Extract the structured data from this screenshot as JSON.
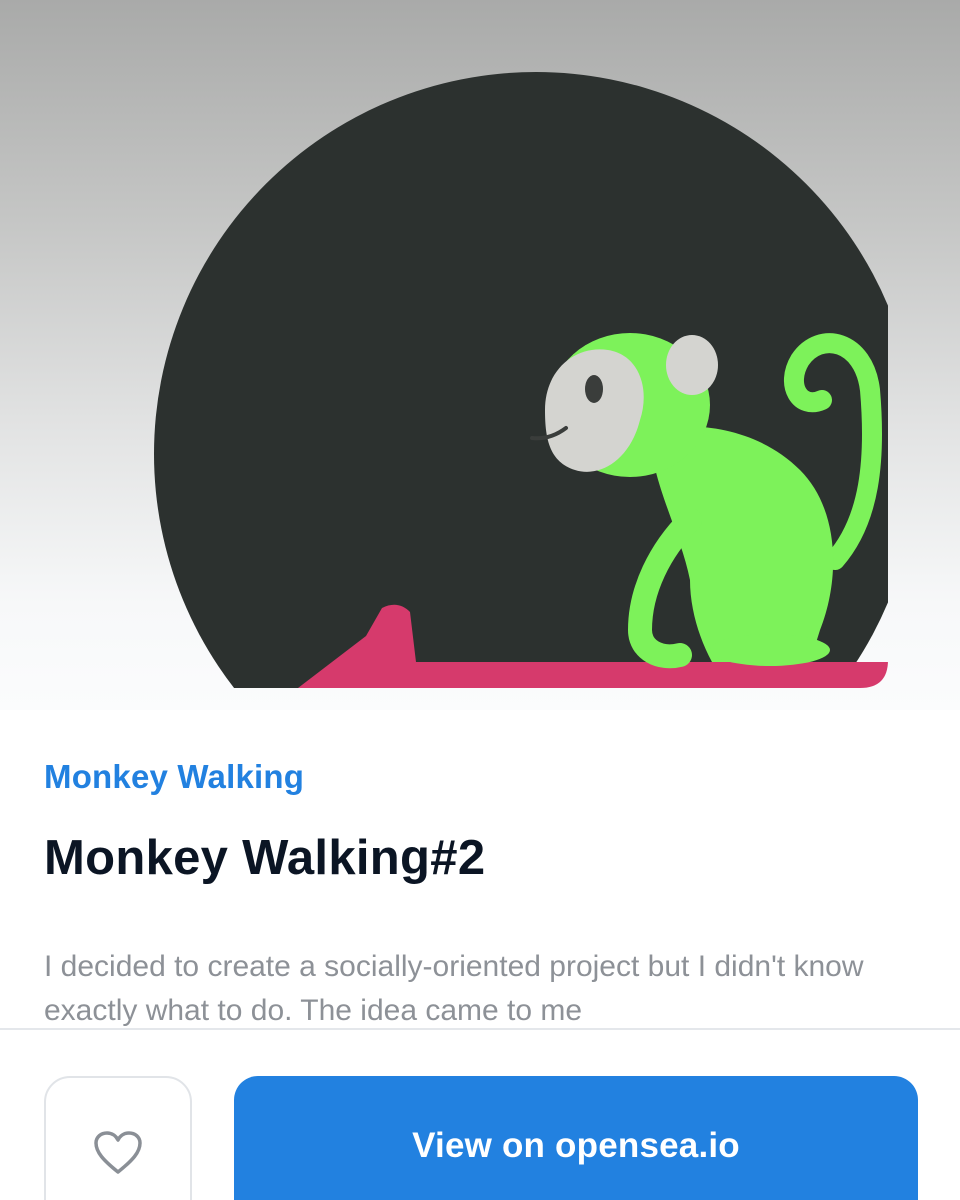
{
  "nft": {
    "collection": "Monkey Walking",
    "title": "Monkey Walking#2",
    "description": "I decided to create a socially-oriented project but I didn't know exactly what to do. The idea came to me"
  },
  "actions": {
    "like_icon": "heart-outline-icon",
    "view_label": "View on opensea.io"
  },
  "colors": {
    "accent": "#2281e0",
    "title": "#0b1524",
    "description": "#8d9197",
    "artwork_circle": "#2c312f",
    "monkey": "#7df25a",
    "monkey_face": "#d4d4d0",
    "arrow": "#d63a6c"
  }
}
